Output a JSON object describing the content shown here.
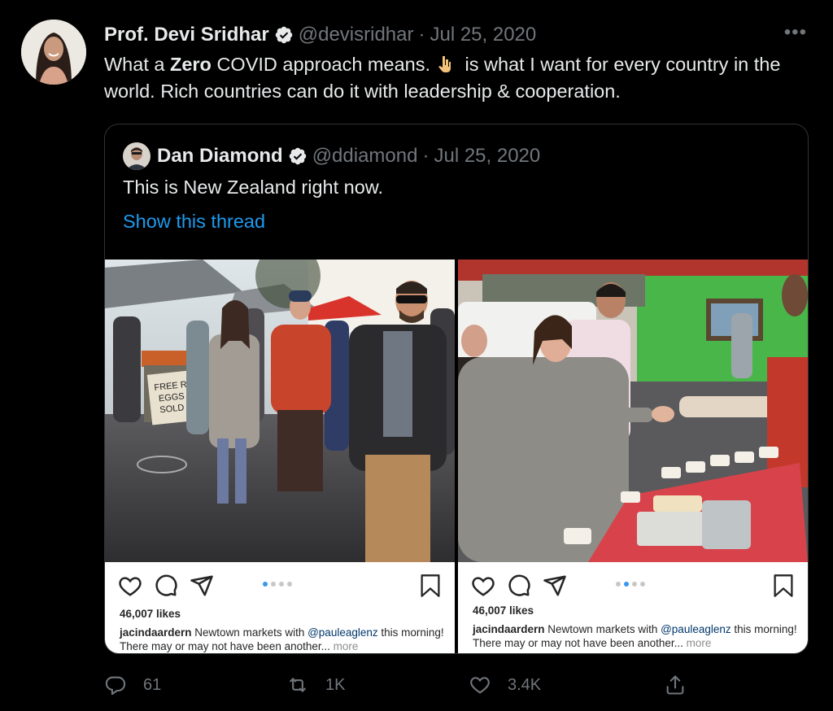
{
  "tweet": {
    "author_name": "Prof. Devi Sridhar",
    "handle": "@devisridhar",
    "separator": "·",
    "date": "Jul 25, 2020",
    "more": "•••",
    "text_part1": "What a ",
    "text_bold": "Zero",
    "text_part2": " COVID approach means.",
    "text_part3": " is what I want for every country in the world. Rich countries can do it with leadership & cooperation."
  },
  "quote": {
    "author_name": "Dan Diamond",
    "handle": "@ddiamond",
    "separator": "·",
    "date": "Jul 25, 2020",
    "text": "This is New Zealand right now.",
    "show_thread": "Show this thread"
  },
  "instagram": [
    {
      "likes": "46,007 likes",
      "username": "jacindaardern",
      "caption_1": " Newtown markets with ",
      "mention": "@pauleaglenz",
      "caption_2": " this morning! There may or may not have been another...",
      "more": " more",
      "active_dot": 0
    },
    {
      "likes": "46,007 likes",
      "username": "jacindaardern",
      "caption_1": " Newtown markets with ",
      "mention": "@pauleaglenz",
      "caption_2": " this morning! There may or may not have been another...",
      "more": " more",
      "active_dot": 1
    }
  ],
  "sign_text": "FREE RANGE EGGS SOLD OUT",
  "actions": {
    "replies": "61",
    "retweets": "1K",
    "likes": "3.4K"
  },
  "colors": {
    "background": "#000000",
    "text": "#e7e9ea",
    "muted": "#71767b",
    "link": "#1d9bf0",
    "verified": "#e7e9ea",
    "border": "#2f3336"
  },
  "icons": [
    "verified-badge-icon",
    "pointing-down-emoji-icon",
    "heart-icon",
    "comment-icon",
    "share-icon",
    "bookmark-icon",
    "reply-icon",
    "retweet-icon",
    "like-icon",
    "upload-icon"
  ]
}
